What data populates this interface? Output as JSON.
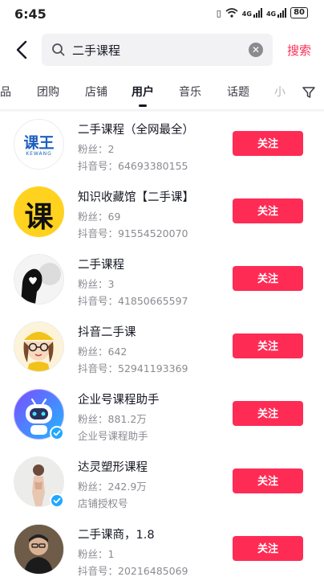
{
  "status": {
    "time": "6:45",
    "battery": "80",
    "net1": "4G",
    "net2": "4G"
  },
  "search": {
    "query": "二手课程",
    "submit_label": "搜索"
  },
  "tabs": [
    {
      "label": "品"
    },
    {
      "label": "团购"
    },
    {
      "label": "店铺"
    },
    {
      "label": "用户",
      "active": true
    },
    {
      "label": "音乐"
    },
    {
      "label": "话题"
    },
    {
      "label": "小"
    }
  ],
  "users": [
    {
      "name": "二手课程（全网最全）",
      "fans": "粉丝：2",
      "sub": "抖音号：64693380155",
      "follow": "关注",
      "avatar_text": "课王",
      "avatar_sub": "KEWANG",
      "verified": false
    },
    {
      "name": "知识收藏馆【二手课】",
      "fans": "粉丝：69",
      "sub": "抖音号：91554520070",
      "follow": "关注",
      "avatar_text": "课",
      "verified": false
    },
    {
      "name": "二手课程",
      "fans": "粉丝：3",
      "sub": "抖音号：41850665597",
      "follow": "关注",
      "verified": false
    },
    {
      "name": "抖音二手课",
      "fans": "粉丝：642",
      "sub": "抖音号：52941193369",
      "follow": "关注",
      "verified": false
    },
    {
      "name": "企业号课程助手",
      "fans": "粉丝：881.2万",
      "sub": "企业号课程助手",
      "follow": "关注",
      "verified": true
    },
    {
      "name": "达灵塑形课程",
      "fans": "粉丝：242.9万",
      "sub": "店铺授权号",
      "follow": "关注",
      "verified": true
    },
    {
      "name": "二手课商，1.8",
      "fans": "粉丝：1",
      "sub": "抖音号：20216485069",
      "follow": "关注",
      "verified": false
    }
  ],
  "colors": {
    "accent": "#fe2c55",
    "verified": "#20a8ff"
  }
}
